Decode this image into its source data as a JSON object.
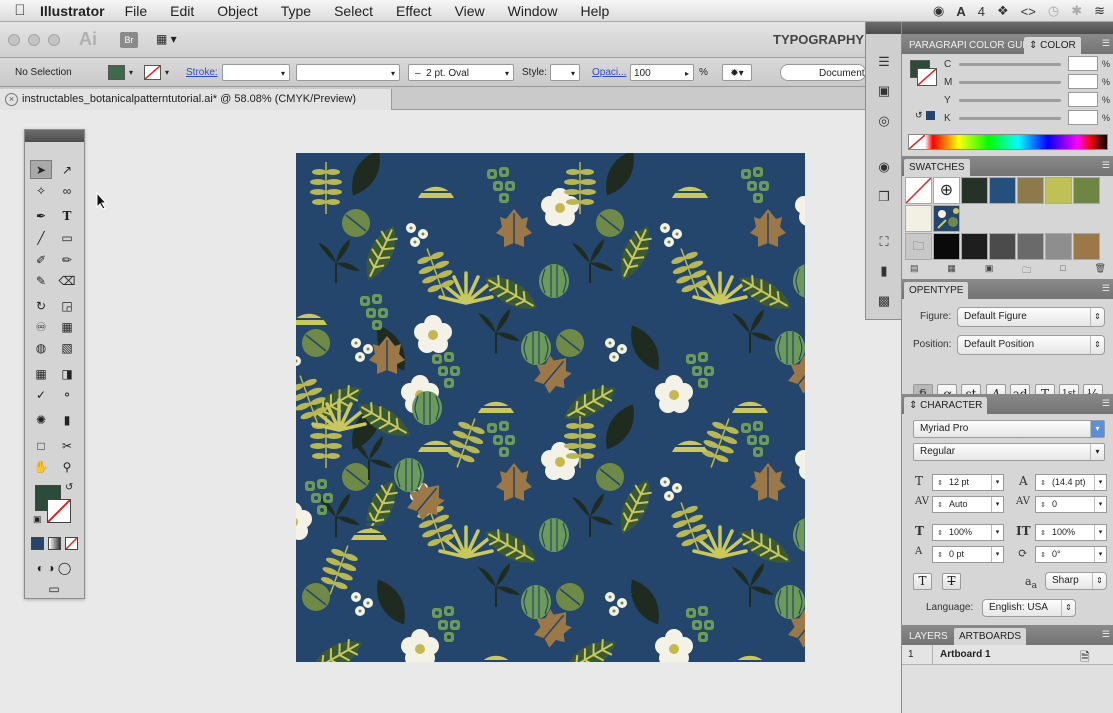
{
  "menubar": {
    "app_name": "Illustrator",
    "items": [
      "File",
      "Edit",
      "Object",
      "Type",
      "Select",
      "Effect",
      "View",
      "Window",
      "Help"
    ],
    "status_number": "4"
  },
  "appbar": {
    "logo": "Ai",
    "bridge_label": "Br",
    "workspace": "TYPOGRAPHY"
  },
  "controlbar": {
    "selection": "No Selection",
    "stroke_label": "Stroke:",
    "brush_value": "2 pt. Oval",
    "style_label": "Style:",
    "opacity_label": "Opaci...",
    "opacity_value": "100",
    "opacity_unit": "%",
    "document_button": "Document"
  },
  "document": {
    "tab_title": "instructables_botanicalpatterntutorial.ai* @ 58.08% (CMYK/Preview)"
  },
  "color_panel": {
    "tabs": [
      "PARAGRAPI",
      "COLOR GUI",
      "COLOR"
    ],
    "channels": [
      "C",
      "M",
      "Y",
      "K"
    ],
    "unit": "%"
  },
  "swatches_panel": {
    "title": "SWATCHES",
    "colors_row1": [
      "#263228",
      "#245080",
      "#8c7a4a",
      "#bfc056",
      "#6e8640"
    ],
    "colors_row3": [
      "#0a0a0a",
      "#1e1e1e",
      "#4b4b4b",
      "#6a6a6a",
      "#8e8e8e",
      "#9c7846"
    ],
    "pale_color": "#f2f0e3",
    "pattern_color": "#24466c"
  },
  "opentype_panel": {
    "title": "OPENTYPE",
    "figure_label": "Figure:",
    "figure_value": "Default Figure",
    "position_label": "Position:",
    "position_value": "Default Position",
    "buttons": [
      "fi",
      "ơ",
      "st",
      "A",
      "ad",
      "T",
      "1st",
      "½"
    ]
  },
  "character_panel": {
    "title": "CHARACTER",
    "font": "Myriad Pro",
    "style": "Regular",
    "size": "12 pt",
    "leading": "(14.4 pt)",
    "kerning": "Auto",
    "tracking": "0",
    "vscale": "100%",
    "hscale": "100%",
    "baseline": "0 pt",
    "rotation": "0°",
    "antialias": "Sharp",
    "language_label": "Language:",
    "language": "English: USA"
  },
  "layers_panel": {
    "tabs": [
      "LAYERS",
      "ARTBOARDS"
    ],
    "row_number": "1",
    "row_name": "Artboard 1"
  }
}
